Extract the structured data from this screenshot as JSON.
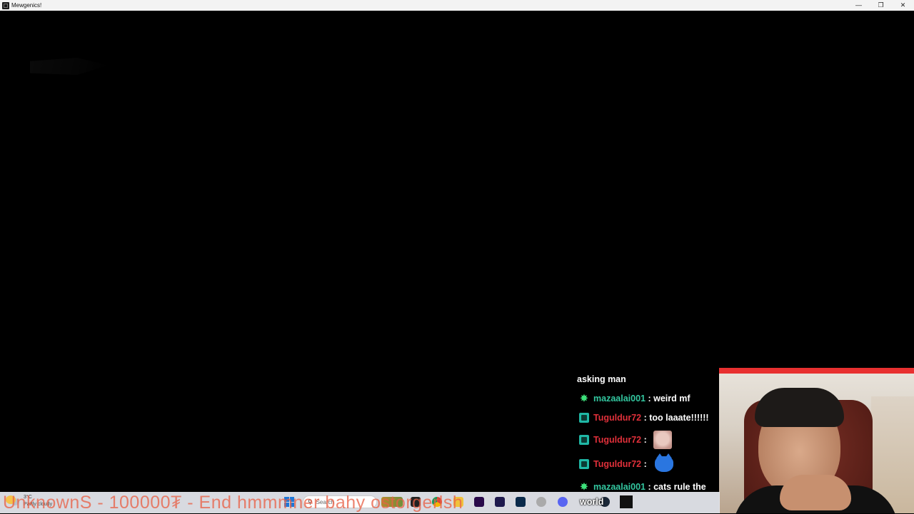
{
  "window": {
    "title": "Mewgenics!",
    "controls": {
      "minimize": "—",
      "restore": "❐",
      "close": "✕"
    }
  },
  "chat": {
    "lines": [
      {
        "text": "asking man"
      },
      {
        "badge": "star",
        "user": "mazaalai001",
        "sep": " : ",
        "message": "weird mf"
      },
      {
        "badge": "sub",
        "user": "Tuguldur72",
        "sep": " : ",
        "message": "too laaate!!!!!!"
      },
      {
        "badge": "sub",
        "user": "Tuguldur72",
        "sep": " : ",
        "emote": "face-emote"
      },
      {
        "badge": "sub",
        "user": "Tuguldur72",
        "sep": " : ",
        "emote": "cat-emote"
      },
      {
        "badge": "star",
        "user": "mazaalai001",
        "sep": " : ",
        "message": "cats rule the"
      },
      {
        "text": "world"
      }
    ],
    "colors": {
      "green_name": "#33c7a0",
      "red_name": "#e0303a"
    }
  },
  "ticker": {
    "text": "UnknownS - 100000₮ - End hmmmner bahy ostorgerlsh"
  },
  "taskbar": {
    "weather": {
      "temp": "3°C",
      "desc": "Partly cloudy"
    },
    "search": {
      "placeholder": "Search"
    },
    "icons": [
      "start-icon",
      "search-icon",
      "widgets-icon",
      "files-icon",
      "chrome-icon",
      "folder-icon",
      "premiere-icon",
      "after-effects-icon",
      "photoshop-icon",
      "settings-icon",
      "discord-icon",
      "steam-icon",
      "obs-icon",
      "mewgenics-icon"
    ]
  }
}
